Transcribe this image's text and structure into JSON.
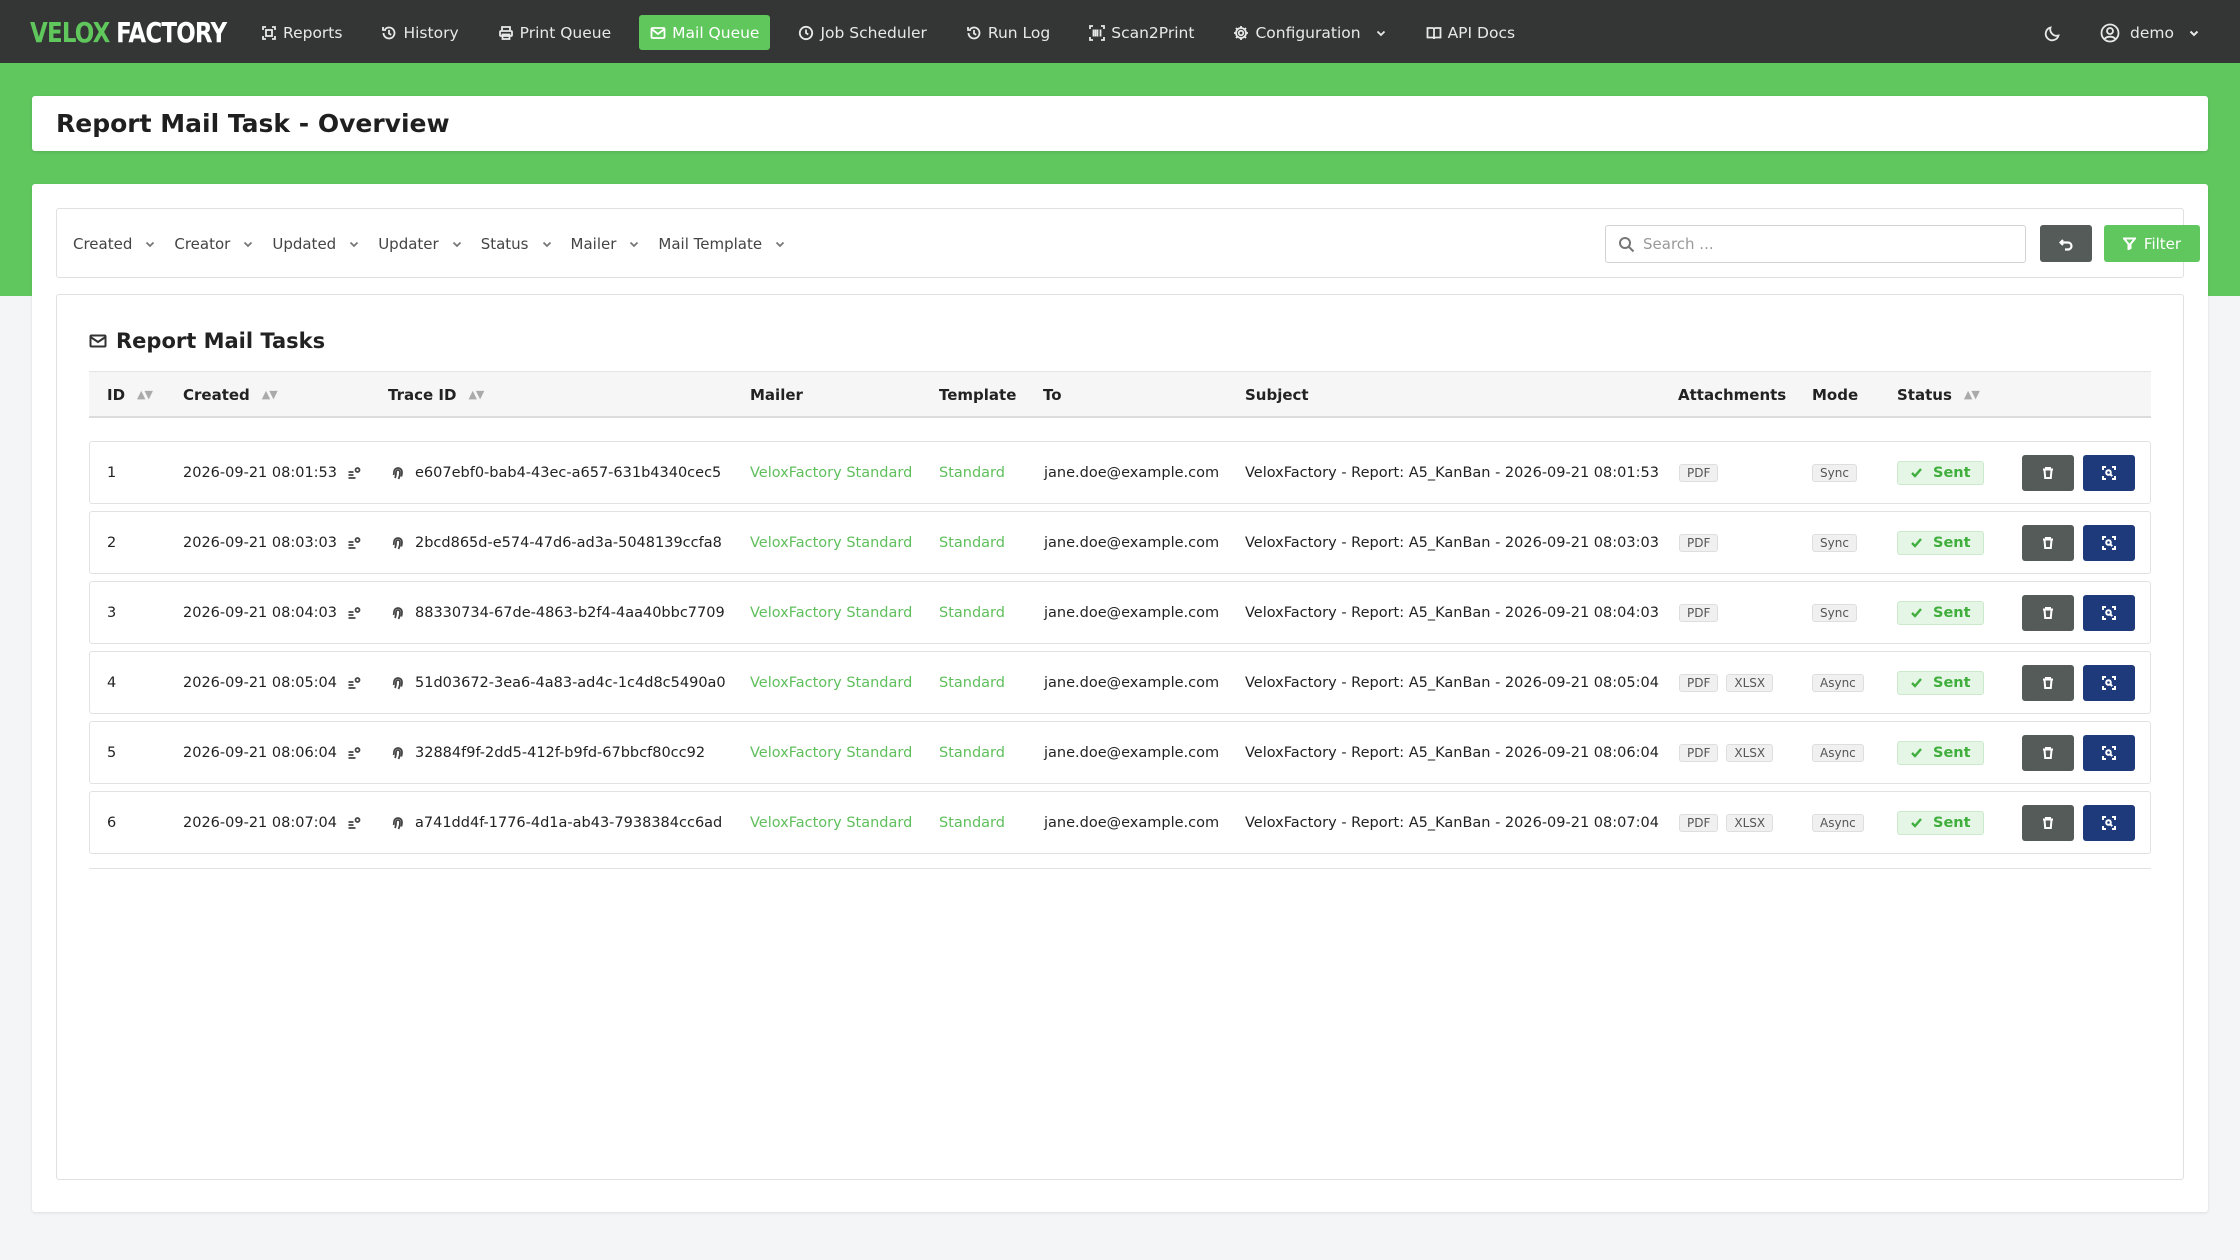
{
  "brand": {
    "part1": "VELOX",
    "part2": "FACTORY"
  },
  "nav": {
    "items": [
      {
        "label": "Reports",
        "icon": "reports-icon"
      },
      {
        "label": "History",
        "icon": "history-icon"
      },
      {
        "label": "Print Queue",
        "icon": "printer-icon"
      },
      {
        "label": "Mail Queue",
        "icon": "mail-icon",
        "active": true
      },
      {
        "label": "Job Scheduler",
        "icon": "clock-icon"
      },
      {
        "label": "Run Log",
        "icon": "history-icon"
      },
      {
        "label": "Scan2Print",
        "icon": "barcode-scan-icon"
      },
      {
        "label": "Configuration",
        "icon": "gear-icon"
      },
      {
        "label": "API Docs",
        "icon": "book-icon"
      }
    ],
    "user": "demo"
  },
  "page": {
    "title": "Report Mail Task - Overview"
  },
  "filters": {
    "items": [
      "Created",
      "Creator",
      "Updated",
      "Updater",
      "Status",
      "Mailer",
      "Mail Template"
    ],
    "search_placeholder": "Search ...",
    "filter_label": "Filter"
  },
  "table": {
    "title": "Report Mail Tasks",
    "headers": {
      "id": "ID",
      "created": "Created",
      "trace_id": "Trace ID",
      "mailer": "Mailer",
      "template": "Template",
      "to": "To",
      "subject": "Subject",
      "attachments": "Attachments",
      "mode": "Mode",
      "status": "Status"
    },
    "rows": [
      {
        "id": "1",
        "created": "2026-09-21 08:01:53",
        "trace_id": "e607ebf0-bab4-43ec-a657-631b4340cec5",
        "mailer": "VeloxFactory Standard",
        "template": "Standard",
        "to": "jane.doe@example.com",
        "subject": "VeloxFactory - Report: A5_KanBan - 2026-09-21 08:01:53",
        "attachments": [
          "PDF"
        ],
        "mode": "Sync",
        "status": "Sent"
      },
      {
        "id": "2",
        "created": "2026-09-21 08:03:03",
        "trace_id": "2bcd865d-e574-47d6-ad3a-5048139ccfa8",
        "mailer": "VeloxFactory Standard",
        "template": "Standard",
        "to": "jane.doe@example.com",
        "subject": "VeloxFactory - Report: A5_KanBan - 2026-09-21 08:03:03",
        "attachments": [
          "PDF"
        ],
        "mode": "Sync",
        "status": "Sent"
      },
      {
        "id": "3",
        "created": "2026-09-21 08:04:03",
        "trace_id": "88330734-67de-4863-b2f4-4aa40bbc7709",
        "mailer": "VeloxFactory Standard",
        "template": "Standard",
        "to": "jane.doe@example.com",
        "subject": "VeloxFactory - Report: A5_KanBan - 2026-09-21 08:04:03",
        "attachments": [
          "PDF"
        ],
        "mode": "Sync",
        "status": "Sent"
      },
      {
        "id": "4",
        "created": "2026-09-21 08:05:04",
        "trace_id": "51d03672-3ea6-4a83-ad4c-1c4d8c5490a0",
        "mailer": "VeloxFactory Standard",
        "template": "Standard",
        "to": "jane.doe@example.com",
        "subject": "VeloxFactory - Report: A5_KanBan - 2026-09-21 08:05:04",
        "attachments": [
          "PDF",
          "XLSX"
        ],
        "mode": "Async",
        "status": "Sent"
      },
      {
        "id": "5",
        "created": "2026-09-21 08:06:04",
        "trace_id": "32884f9f-2dd5-412f-b9fd-67bbcf80cc92",
        "mailer": "VeloxFactory Standard",
        "template": "Standard",
        "to": "jane.doe@example.com",
        "subject": "VeloxFactory - Report: A5_KanBan - 2026-09-21 08:06:04",
        "attachments": [
          "PDF",
          "XLSX"
        ],
        "mode": "Async",
        "status": "Sent"
      },
      {
        "id": "6",
        "created": "2026-09-21 08:07:04",
        "trace_id": "a741dd4f-1776-4d1a-ab43-7938384cc6ad",
        "mailer": "VeloxFactory Standard",
        "template": "Standard",
        "to": "jane.doe@example.com",
        "subject": "VeloxFactory - Report: A5_KanBan - 2026-09-21 08:07:04",
        "attachments": [
          "PDF",
          "XLSX"
        ],
        "mode": "Async",
        "status": "Sent"
      }
    ]
  },
  "colors": {
    "primary": "#60c75e",
    "navbar": "#333634",
    "dark_button": "#545b58",
    "scan_button": "#1f3a7a"
  }
}
